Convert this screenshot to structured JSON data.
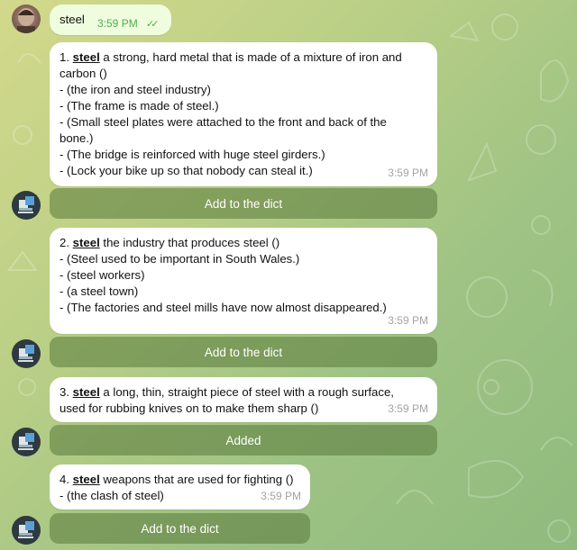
{
  "user_message": {
    "text": "steel",
    "time": "3:59 PM",
    "ticks": "✓✓"
  },
  "entries": [
    {
      "number": "1.",
      "word": "steel",
      "definition_lines": [
        "a strong, hard metal that is made of a mixture of iron and",
        "carbon ()"
      ],
      "examples": [
        "- (the iron and steel industry)",
        "- (The frame is made of steel.)",
        "- (Small steel plates were attached to the front and back of the",
        "bone.)",
        "- (The bridge is reinforced with huge steel girders.)",
        "- (Lock your bike up so that nobody can steal it.)"
      ],
      "time": "3:59 PM",
      "button": "Add to the dict"
    },
    {
      "number": "2.",
      "word": "steel",
      "definition_lines": [
        "the industry that produces steel ()"
      ],
      "examples": [
        "- (Steel used to be important in South Wales.)",
        "- (steel workers)",
        "- (a steel town)",
        "- (The factories and steel mills have now almost disappeared.)"
      ],
      "time": "3:59 PM",
      "button": "Add to the dict"
    },
    {
      "number": "3.",
      "word": "steel",
      "definition_lines": [
        "a long, thin, straight piece of steel with a rough surface,",
        "used for rubbing knives on to make them sharp ()"
      ],
      "examples": [],
      "time": "3:59 PM",
      "button": "Added"
    },
    {
      "number": "4.",
      "word": "steel",
      "definition_lines": [
        "weapons that are used for fighting ()"
      ],
      "examples": [
        "- (the clash of steel)"
      ],
      "time": "3:59 PM",
      "button": "Add to the dict"
    }
  ],
  "icons": {
    "user_avatar": "user-avatar",
    "bot_avatar": "dictionary-bot-icon"
  },
  "colors": {
    "outgoing_bubble": "#effdde",
    "incoming_bubble": "#ffffff",
    "button_bg": "#6f8f4a",
    "background": "#a9c986"
  }
}
